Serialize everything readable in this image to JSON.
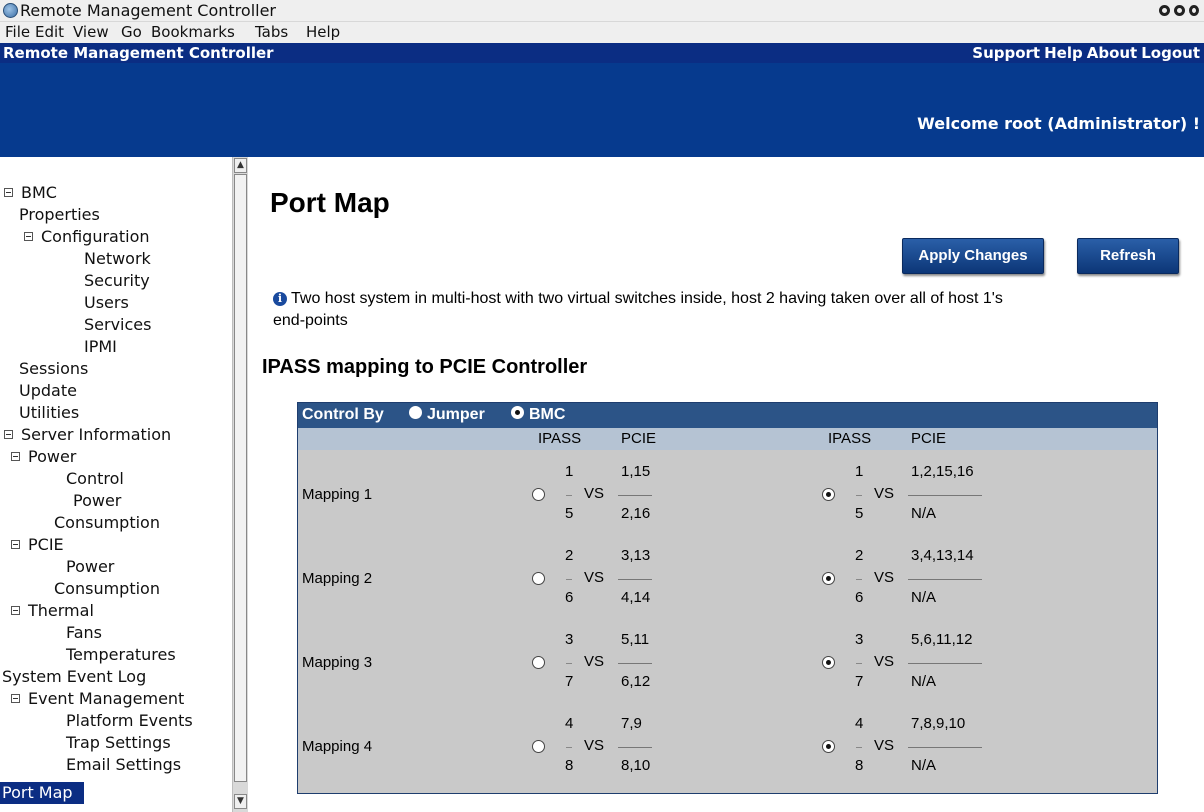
{
  "window": {
    "title": "Remote Management Controller"
  },
  "menubar": [
    "File",
    "Edit",
    "View",
    "Go",
    "Bookmarks",
    "Tabs",
    "Help"
  ],
  "header": {
    "app_title": "Remote Management Controller",
    "links": [
      "Support",
      "Help",
      "About",
      "Logout"
    ],
    "welcome": "Welcome root (Administrator) !"
  },
  "tree": {
    "bmc": "BMC",
    "properties": "Properties",
    "configuration": "Configuration",
    "network": "Network",
    "security": "Security",
    "users": "Users",
    "services": "Services",
    "ipmi": "IPMI",
    "sessions": "Sessions",
    "update": "Update",
    "utilities": "Utilities",
    "server_information": "Server Information",
    "power": "Power",
    "control": "Control",
    "power_power": "Power",
    "power_consumption": "Consumption",
    "pcie": "PCIE",
    "pcie_power": "Power",
    "pcie_consumption": "Consumption",
    "thermal": "Thermal",
    "fans": "Fans",
    "temperatures": "Temperatures",
    "system_event_log": "System Event Log",
    "event_management": "Event Management",
    "platform_events": "Platform Events",
    "trap_settings": "Trap Settings",
    "email_settings": "Email Settings",
    "port_map": "Port Map"
  },
  "page": {
    "title": "Port Map",
    "apply_label": "Apply Changes",
    "refresh_label": "Refresh",
    "info_line1": "Two host system in multi-host with two virtual switches inside, host 2 having taken over all of host 1's",
    "info_line2": "end-points",
    "section_title": "IPASS mapping to PCIE Controller"
  },
  "table": {
    "control_by": "Control By",
    "jumper": "Jumper",
    "bmc": "BMC",
    "control_selected": "BMC",
    "col_ipass": "IPASS",
    "col_pcie": "PCIE",
    "vs": "VS",
    "rows": [
      {
        "label": "Mapping 1",
        "selected": "right",
        "left": {
          "ipass_top": "1",
          "ipass_bottom": "5",
          "pcie_top": "1,15",
          "pcie_bottom": "2,16"
        },
        "right": {
          "ipass_top": "1",
          "ipass_bottom": "5",
          "pcie_top": "1,2,15,16",
          "pcie_bottom": "N/A"
        }
      },
      {
        "label": "Mapping 2",
        "selected": "right",
        "left": {
          "ipass_top": "2",
          "ipass_bottom": "6",
          "pcie_top": "3,13",
          "pcie_bottom": "4,14"
        },
        "right": {
          "ipass_top": "2",
          "ipass_bottom": "6",
          "pcie_top": "3,4,13,14",
          "pcie_bottom": "N/A"
        }
      },
      {
        "label": "Mapping 3",
        "selected": "right",
        "left": {
          "ipass_top": "3",
          "ipass_bottom": "7",
          "pcie_top": "5,11",
          "pcie_bottom": "6,12"
        },
        "right": {
          "ipass_top": "3",
          "ipass_bottom": "7",
          "pcie_top": "5,6,11,12",
          "pcie_bottom": "N/A"
        }
      },
      {
        "label": "Mapping 4",
        "selected": "right",
        "left": {
          "ipass_top": "4",
          "ipass_bottom": "8",
          "pcie_top": "7,9",
          "pcie_bottom": "8,10"
        },
        "right": {
          "ipass_top": "4",
          "ipass_bottom": "8",
          "pcie_top": "7,8,9,10",
          "pcie_bottom": "N/A"
        }
      }
    ]
  },
  "colors": {
    "header_blue": "#0b2d83",
    "banner_blue": "#063a8e",
    "table_header": "#2c5487",
    "table_body": "#c9c9c9"
  }
}
